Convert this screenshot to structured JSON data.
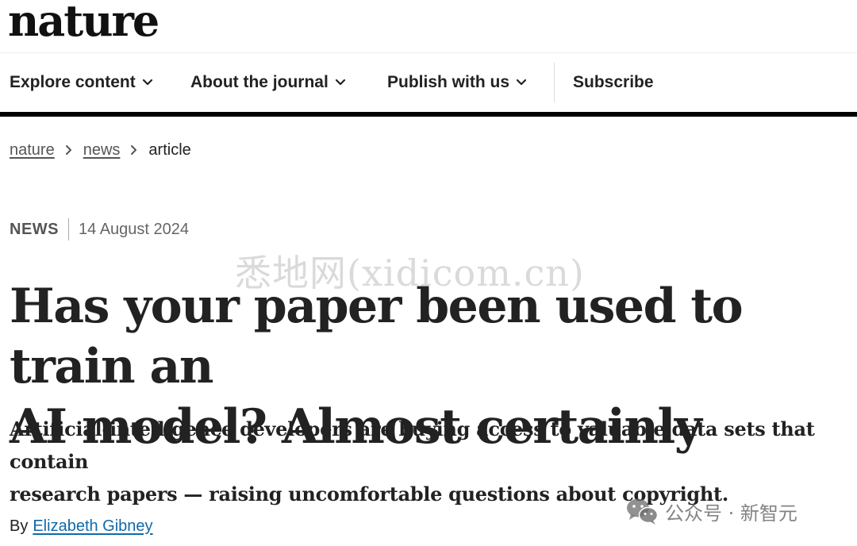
{
  "header": {
    "logo_text": "nature"
  },
  "nav": {
    "items": [
      {
        "label": "Explore content",
        "icon": "chevron-down-icon"
      },
      {
        "label": "About the journal",
        "icon": "chevron-down-icon"
      },
      {
        "label": "Publish with us",
        "icon": "chevron-down-icon"
      }
    ],
    "subscribe_label": "Subscribe"
  },
  "breadcrumb": {
    "items": [
      "nature",
      "news"
    ],
    "current": "article",
    "separator_icon": "chevron-right-icon"
  },
  "article": {
    "type": "NEWS",
    "date": "14 August 2024",
    "title_line1": "Has your paper been used to train an",
    "title_line2": "AI model? Almost certainly",
    "standfirst_line1": "Artificial-intelligence developers are buying access to valuable data sets that contain",
    "standfirst_line2": "research papers — raising uncomfortable questions about copyright.",
    "byline_prefix": "By",
    "author": "Elizabeth Gibney"
  },
  "watermarks": {
    "center": "悉地网(xidicom.cn)",
    "wechat": "公众号 · 新智元",
    "wechat_icon": "wechat-icon"
  },
  "colors": {
    "text": "#222222",
    "nav_bar": "#000000",
    "author_link": "#0f6aa8",
    "muted": "#555555"
  }
}
